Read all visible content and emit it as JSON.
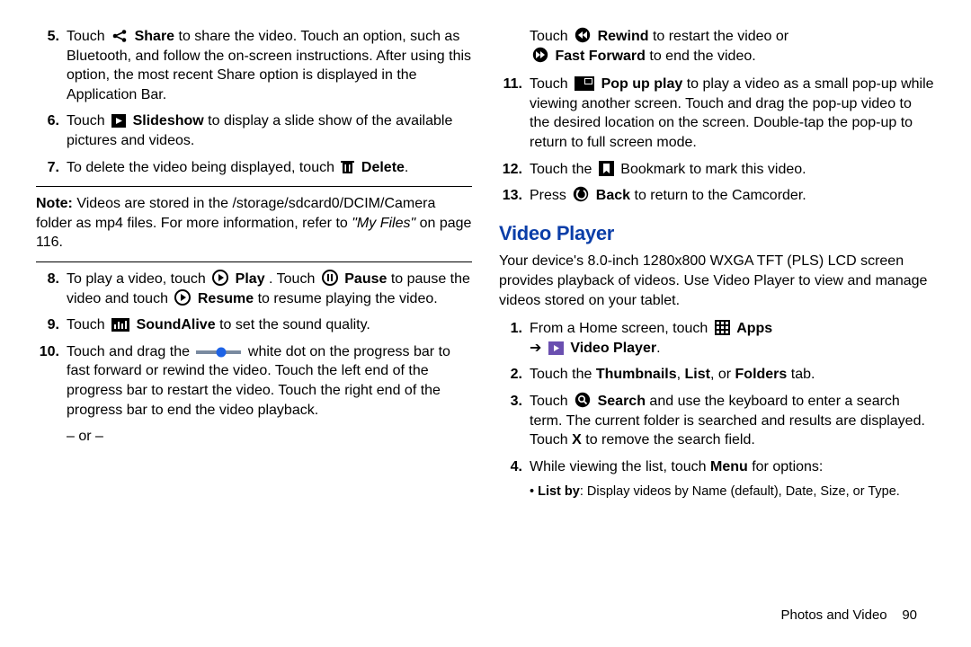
{
  "left": {
    "i5": {
      "t1": "Touch ",
      "lbl": "Share",
      "t2": " to share the video. Touch an option, such as Bluetooth, and follow the on-screen instructions. After using this option, the most recent Share option is displayed in the Application Bar."
    },
    "i6": {
      "t1": "Touch ",
      "lbl": "Slideshow",
      "t2": " to display a slide show of the available pictures and videos."
    },
    "i7": {
      "t1": "To delete the video being displayed, touch ",
      "lbl": "Delete",
      "t2": "."
    },
    "note_lead": "Note:",
    "note_body1": " Videos are stored in the /storage/sdcard0/DCIM/Camera folder as mp4 files. For more information, refer to ",
    "note_ital": "\"My Files\"",
    "note_body2": " on page 116.",
    "i8": {
      "t1": "To play a video, touch ",
      "play": "Play",
      "t2": ". Touch ",
      "pause": "Pause",
      "t3": " to pause the video and touch ",
      "resume": "Resume",
      "t4": " to resume playing the video."
    },
    "i9": {
      "t1": "Touch ",
      "lbl": "SoundAlive",
      "t2": " to set the sound quality."
    },
    "i10": {
      "t1": "Touch and drag the ",
      "t2": " white dot on the progress bar to fast forward or rewind the video. Touch the left end of the progress bar to restart the video. Touch the right end of the progress bar to end the video playback."
    },
    "or": "– or –"
  },
  "right": {
    "cont": {
      "t1": "Touch ",
      "rew": "Rewind",
      "t2": " to restart the video or ",
      "ff": "Fast Forward",
      "t3": " to end the video."
    },
    "i11": {
      "t1": "Touch ",
      "lbl": "Pop up play",
      "t2": " to play a video as a small pop-up while viewing another screen. Touch and drag the pop-up video to the desired location on the screen. Double-tap the pop-up to return to full screen mode."
    },
    "i12": {
      "t1": "Touch the ",
      "t2": " Bookmark to mark this video."
    },
    "i13": {
      "t1": "Press ",
      "lbl": "Back",
      "t2": " to return to the Camcorder."
    },
    "section": "Video Player",
    "intro": "Your device's 8.0-inch 1280x800 WXGA TFT (PLS) LCD screen provides playback of videos. Use Video Player to view and manage videos stored on your tablet.",
    "s1": {
      "t1": "From a Home screen, touch ",
      "apps": "Apps",
      "arrow": "➔ ",
      "vp": "Video Player",
      "t2": "."
    },
    "s2": {
      "t1": "Touch the ",
      "a": "Thumbnails",
      "c1": ", ",
      "b": "List",
      "c2": ", or ",
      "c": "Folders",
      "t2": " tab."
    },
    "s3": {
      "t1": "Touch ",
      "lbl": "Search",
      "t2": " and use the keyboard to enter a search term. The current folder is searched and results are displayed. Touch ",
      "x": "X",
      "t3": " to remove the search field."
    },
    "s4": {
      "t1": "While viewing the list, touch ",
      "menu": "Menu",
      "t2": " for options:"
    },
    "b1_lead": "List by",
    "b1_body": ": Display videos by Name (default), Date, Size, or Type."
  },
  "footer": {
    "section": "Photos and Video",
    "page": "90"
  }
}
